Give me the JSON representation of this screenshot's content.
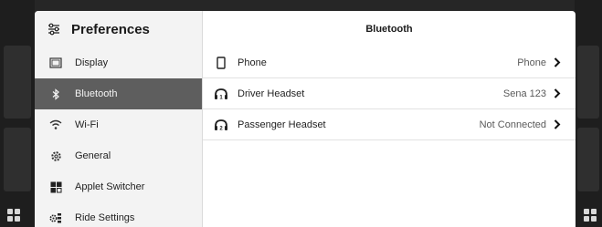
{
  "sidebar": {
    "title": "Preferences",
    "items": [
      {
        "label": "Display",
        "icon": "display-icon"
      },
      {
        "label": "Bluetooth",
        "icon": "bluetooth-icon",
        "active": true
      },
      {
        "label": "Wi-Fi",
        "icon": "wifi-icon"
      },
      {
        "label": "General",
        "icon": "gear-icon"
      },
      {
        "label": "Applet Switcher",
        "icon": "applet-switcher-icon"
      },
      {
        "label": "Ride Settings",
        "icon": "ride-settings-icon"
      }
    ]
  },
  "main": {
    "title": "Bluetooth",
    "rows": [
      {
        "label": "Phone",
        "value": "Phone",
        "icon": "phone-icon"
      },
      {
        "label": "Driver Headset",
        "value": "Sena 123",
        "icon": "headset-1-icon"
      },
      {
        "label": "Passenger Headset",
        "value": "Not Connected",
        "icon": "headset-2-icon"
      }
    ]
  },
  "colors": {
    "active_item_bg": "#5e5e5e",
    "sidebar_bg": "#f3f3f3",
    "background": "#1e1e1e"
  }
}
